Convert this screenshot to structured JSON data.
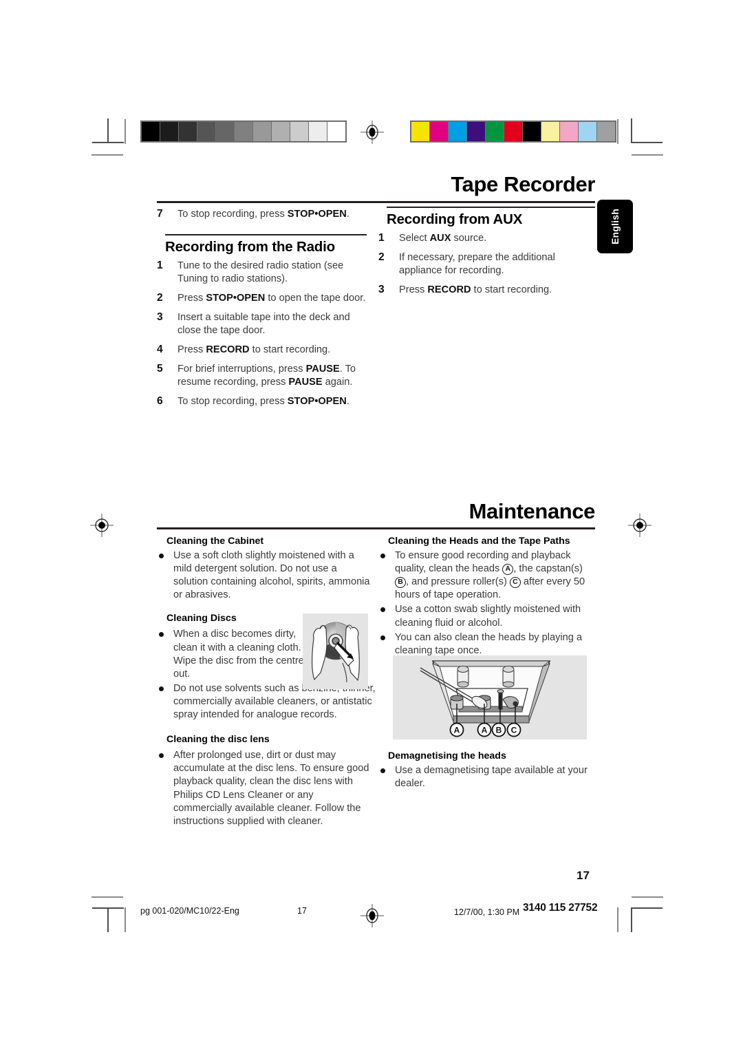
{
  "document": {
    "chapter_title": "Tape Recorder",
    "section_title": "Maintenance",
    "language_tab": "English",
    "page_number": "17"
  },
  "tape_recorder": {
    "left_column": {
      "continued_step": {
        "num": "7",
        "text_pre": "To stop recording, press ",
        "bold": "STOP•OPEN",
        "text_post": "."
      },
      "heading": "Recording from the Radio",
      "steps": [
        {
          "num": "1",
          "pre": "Tune to the desired radio station (see Tuning to radio stations).",
          "bold": "",
          "post": ""
        },
        {
          "num": "2",
          "pre": "Press ",
          "bold": "STOP•OPEN",
          "post": " to open the tape door."
        },
        {
          "num": "3",
          "pre": "Insert a suitable tape into the deck and close the tape door.",
          "bold": "",
          "post": ""
        },
        {
          "num": "4",
          "pre": "Press ",
          "bold": "RECORD",
          "post": " to start recording."
        },
        {
          "num": "5",
          "pre": "For brief interruptions, press ",
          "bold": "PAUSE",
          "post": ". To resume recording, press ",
          "bold2": "PAUSE",
          "post2": " again."
        },
        {
          "num": "6",
          "pre": "To stop recording, press ",
          "bold": "STOP•OPEN",
          "post": "."
        }
      ]
    },
    "right_column": {
      "heading": "Recording from AUX",
      "steps": [
        {
          "num": "1",
          "pre": "Select ",
          "bold": "AUX",
          "post": " source."
        },
        {
          "num": "2",
          "pre": "If necessary, prepare the additional appliance for recording.",
          "bold": "",
          "post": ""
        },
        {
          "num": "3",
          "pre": "Press ",
          "bold": "RECORD",
          "post": " to start recording."
        }
      ]
    }
  },
  "maintenance": {
    "left_column": {
      "cabinet": {
        "heading": "Cleaning the Cabinet",
        "bullets": [
          "Use a soft cloth slightly moistened with a mild detergent solution. Do not use a solution containing alcohol, spirits, ammonia or abrasives."
        ]
      },
      "discs": {
        "heading": "Cleaning Discs",
        "bullets": [
          "When a disc becomes dirty, clean it with a cleaning cloth. Wipe the disc from the centre out.",
          "Do not use solvents such as benzine, thinner, commercially available cleaners, or antistatic spray intended for analogue records."
        ]
      },
      "disc_lens": {
        "heading": "Cleaning the disc lens",
        "bullets": [
          "After prolonged use, dirt or dust may accumulate at the disc lens. To ensure good playback quality, clean the disc lens with Philips CD Lens Cleaner or any commercially available cleaner. Follow the instructions supplied with cleaner."
        ]
      },
      "figure_caption": "disc-cleaning-illustration"
    },
    "right_column": {
      "heads": {
        "heading": "Cleaning the Heads and the Tape Paths",
        "bullet1_parts": {
          "p1": "To ensure good recording and playback quality, clean the heads ",
          "a": "A",
          "p2": ", the capstan(s) ",
          "b": "B",
          "p3": ", and pressure roller(s) ",
          "c": "C",
          "p4": " after every 50 hours of tape operation."
        },
        "bullets": [
          "Use a cotton swab slightly moistened with cleaning fluid or alcohol.",
          "You can also clean the heads by playing a cleaning tape once."
        ]
      },
      "figure_labels": [
        "A",
        "A",
        "B",
        "C"
      ],
      "demagnetising": {
        "heading": "Demagnetising the heads",
        "bullets": [
          "Use a demagnetising tape available at your dealer."
        ]
      }
    }
  },
  "footer": {
    "file_label": "pg 001-020/MC10/22-Eng",
    "page_label": "17",
    "timestamp": "12/7/00, 1:30 PM",
    "doc_code": "3140 115 27752"
  },
  "calibration": {
    "grey_steps": [
      "#000000",
      "#1c1c1c",
      "#333333",
      "#555555",
      "#666666",
      "#808080",
      "#999999",
      "#b0b0b0",
      "#cccccc",
      "#ededed",
      "#ffffff"
    ],
    "colour_steps": [
      "#f5e400",
      "#e00080",
      "#009fe3",
      "#3d0f7a",
      "#009640",
      "#e2001a",
      "#000000",
      "#faf0a0",
      "#f4a7c4",
      "#9fd4f2",
      "#a0a0a0"
    ]
  }
}
